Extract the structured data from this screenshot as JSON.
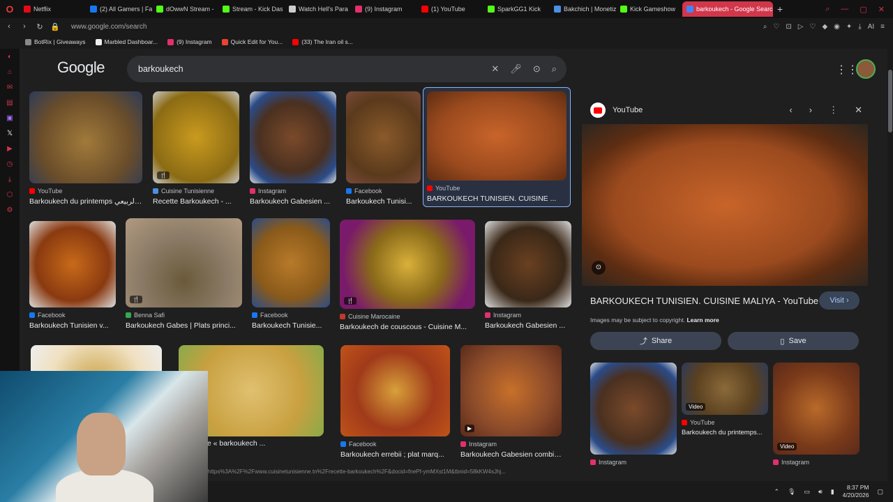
{
  "browser": {
    "tabs": [
      {
        "label": "Netflix",
        "color": "#e50914"
      },
      {
        "label": "(2) All Gamers | Fa",
        "color": "#1877f2"
      },
      {
        "label": "dOwwN Stream - ",
        "color": "#53fc18"
      },
      {
        "label": "Stream - Kick Das",
        "color": "#53fc18"
      },
      {
        "label": "Watch Hell's Para",
        "color": "#cccccc"
      },
      {
        "label": "(9) Instagram",
        "color": "#e1306c"
      },
      {
        "label": "(1) YouTube",
        "color": "#ff0000"
      },
      {
        "label": "SparkGG1 Kick",
        "color": "#53fc18"
      },
      {
        "label": "Bakchich | Monetiz",
        "color": "#4a90e2"
      },
      {
        "label": "Kick Gameshow",
        "color": "#53fc18"
      },
      {
        "label": "barkoukech - Google Search",
        "color": "#4285f4"
      }
    ],
    "url": "www.google.com/search",
    "bookmarks": [
      {
        "label": "BotRix | Giveaways",
        "color": "#888"
      },
      {
        "label": "Marbled Dashboar...",
        "color": "#eee"
      },
      {
        "label": "(9) Instagram",
        "color": "#e1306c"
      },
      {
        "label": "Quick Edit for You...",
        "color": "#ea4335"
      },
      {
        "label": "(33) The Iran oil s...",
        "color": "#ff0000"
      }
    ],
    "ext_label": "AI"
  },
  "search": {
    "logo": "Google",
    "query": "barkoukech"
  },
  "results": [
    {
      "source": "YouTube",
      "source_color": "#ff0000",
      "caption": "Barkoukech du printemps البركوكش الربيعي ...",
      "grad": "radial-gradient(circle at 50% 55%, #a17a3a, #6a4d2a 60%, #2d3b58)"
    },
    {
      "source": "Cuisine Tunisienne",
      "source_color": "#4a90e2",
      "caption": "Recette Barkoukech - ...",
      "grad": "radial-gradient(circle, #c99a1e, #8b6b14 70%, #c8c8c8)",
      "badge": "🍴"
    },
    {
      "source": "Instagram",
      "source_color": "#e1306c",
      "caption": "Barkoukech Gabesien ...",
      "grad": "radial-gradient(circle, #7a4a2a, #4a3020 55%, #2a4c8a 80%, #dddddd)"
    },
    {
      "source": "Facebook",
      "source_color": "#1877f2",
      "caption": "Barkoukech Tunisi...",
      "grad": "radial-gradient(circle, #8a5a2a, #5a3a1c 65%, #7a4a3a)"
    },
    {
      "source": "YouTube",
      "source_color": "#ff0000",
      "caption": "BARKOUKECH TUNISIEN. CUISINE ...",
      "grad": "radial-gradient(ellipse, #c8642a, #9b4a1e 60%, #5e2d12)"
    },
    {
      "source": "Facebook",
      "source_color": "#1877f2",
      "caption": "Barkoukech Tunisien v...",
      "grad": "radial-gradient(circle, #c86a1a, #8a3a10 60%, #ddd)"
    },
    {
      "source": "Benna Safi",
      "source_color": "#34a853",
      "caption": "Barkoukech Gabes | Plats princi...",
      "grad": "radial-gradient(circle at 50% 70%, #6a5a3a, #8a7a66 50%, #b09a80)",
      "badge": "🍴"
    },
    {
      "source": "Facebook",
      "source_color": "#1877f2",
      "caption": "Barkoukech Tunisie...",
      "grad": "radial-gradient(circle, #b87a2a, #8a5a1a 60%, #2a4c8a)"
    },
    {
      "source": "Cuisine Marocaine",
      "source_color": "#c0392b",
      "caption": "Barkoukech de couscous - Cuisine M...",
      "grad": "radial-gradient(circle, #d8b03a, #8a6a1a 45%, #7a1a6a 80%)",
      "badge": "🍴"
    },
    {
      "source": "Instagram",
      "source_color": "#e1306c",
      "caption": "Barkoukech Gabesien ...",
      "grad": "radial-gradient(circle, #6a4020, #3a2818 60%, #ddd)"
    },
    {
      "source": "",
      "source_color": "#888",
      "caption": "",
      "grad": "radial-gradient(circle, #c8a040, #f0e0c0 60%, #eeeeee)"
    },
    {
      "source": "",
      "source_color": "#888",
      "caption": "u jour : Le « barkoukech ...",
      "grad": "radial-gradient(circle, #e0c070, #c8a040 60%, #8aaa4a)"
    },
    {
      "source": "Facebook",
      "source_color": "#1877f2",
      "caption": "Barkoukech errebii ; plat marq...",
      "grad": "radial-gradient(circle, #d8a03a, #a03a1a 55%, #c0531a)"
    },
    {
      "source": "Instagram",
      "source_color": "#e1306c",
      "caption": "Barkoukech Gabesien combin...",
      "grad": "radial-gradient(circle, #c8702a, #8a4a2a 60%, #5a2a1a)",
      "badge": "▶"
    }
  ],
  "panel": {
    "source": "YouTube",
    "title": "BARKOUKECH TUNISIEN. CUISINE MALIYA - YouTube",
    "visit_label": "Visit",
    "copyright": "Images may be subject to copyright.",
    "learn_more": "Learn more",
    "share_label": "Share",
    "save_label": "Save",
    "related": [
      {
        "source": "Instagram",
        "source_color": "#e1306c",
        "caption": "",
        "grad": "radial-gradient(circle, #7a4a2a, #4a3020 55%, #2a4c8a 80%, #ddd)"
      },
      {
        "source": "YouTube",
        "source_color": "#ff0000",
        "caption": "Barkoukech du printemps...",
        "grad": "radial-gradient(circle, #8a6a3a, #5a4020 60%, #2d3b58)",
        "badge": "Video"
      },
      {
        "source": "Instagram",
        "source_color": "#e1306c",
        "caption": "",
        "grad": "radial-gradient(circle, #b86a2a, #7a3a1a 60%, #5a2a1a)",
        "badge": "Video"
      }
    ]
  },
  "status_url": "https%3A%2F%2Fwww.cuisinetunisienne.tn%2Frecette-barkoukech%2F&docid=fnePf-ymMXst1M&tbnid=58kKW4sJhj...",
  "taskbar": {
    "time": "8:37 PM",
    "date": "4/20/2026"
  }
}
